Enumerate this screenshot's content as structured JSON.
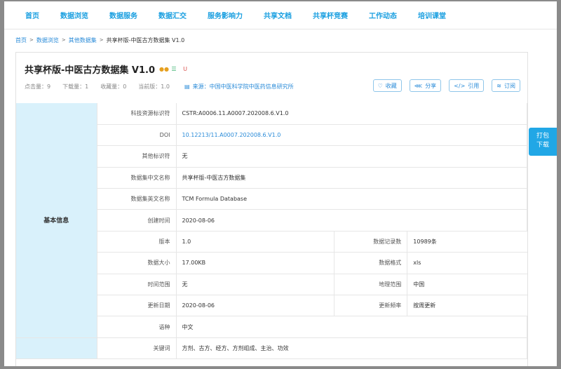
{
  "nav": [
    "首页",
    "数据浏览",
    "数据服务",
    "数据汇交",
    "服务影响力",
    "共享文档",
    "共享杯竞赛",
    "工作动态",
    "培训课堂"
  ],
  "breadcrumb": {
    "items": [
      "首页",
      "数据浏览",
      "其他数据集"
    ],
    "current": "共享杯版-中医古方数据集 V1.0",
    "sep": ">"
  },
  "dataset": {
    "title": "共享杯版-中医古方数据集 V1.0",
    "stats": {
      "clicks_label": "点击量：",
      "clicks": "9",
      "downloads_label": "下载量：",
      "downloads": "1",
      "favorites_label": "收藏量：",
      "favorites": "0",
      "version_label": "当前版：",
      "version": "1.0"
    },
    "source": "来源：中国中医科学院中医药信息研究所"
  },
  "actions": {
    "favorite": "收藏",
    "share": "分享",
    "cite": "引用",
    "subscribe": "订阅"
  },
  "float_button": {
    "line1": "打包",
    "line2": "下载"
  },
  "info": {
    "section_label": "基本信息",
    "rows": [
      {
        "label": "科技资源标识符",
        "value": "CSTR:A0006.11.A0007.202008.6.V1.0"
      },
      {
        "label": "DOI",
        "value": "10.12213/11.A0007.202008.6.V1.0"
      },
      {
        "label": "其他标识符",
        "value": "无"
      },
      {
        "label": "数据集中文名称",
        "value": "共享杯版-中医古方数据集"
      },
      {
        "label": "数据集英文名称",
        "value": "TCM Formula Database"
      },
      {
        "label": "创建时间",
        "value": "2020-08-06"
      }
    ],
    "pair_rows": [
      {
        "label": "版本",
        "value": "1.0",
        "label2": "数据记录数",
        "value2": "10989条"
      },
      {
        "label": "数据大小",
        "value": "17.00KB",
        "label2": "数据格式",
        "value2": "xls"
      },
      {
        "label": "时间范围",
        "value": "无",
        "label2": "地理范围",
        "value2": "中国"
      },
      {
        "label": "更新日期",
        "value": "2020-08-06",
        "label2": "更新频率",
        "value2": "按周更新"
      }
    ],
    "language": {
      "label": "语种",
      "value": "中文"
    },
    "keywords": {
      "label": "关键词",
      "value": "方剂、古方、经方、方剂组成、主治、功效"
    }
  },
  "colors": {
    "nav_text": "#1a9fe0",
    "link": "#2a8bd8",
    "side_bg": "#d9f1fb",
    "float_btn": "#21a7e6"
  }
}
